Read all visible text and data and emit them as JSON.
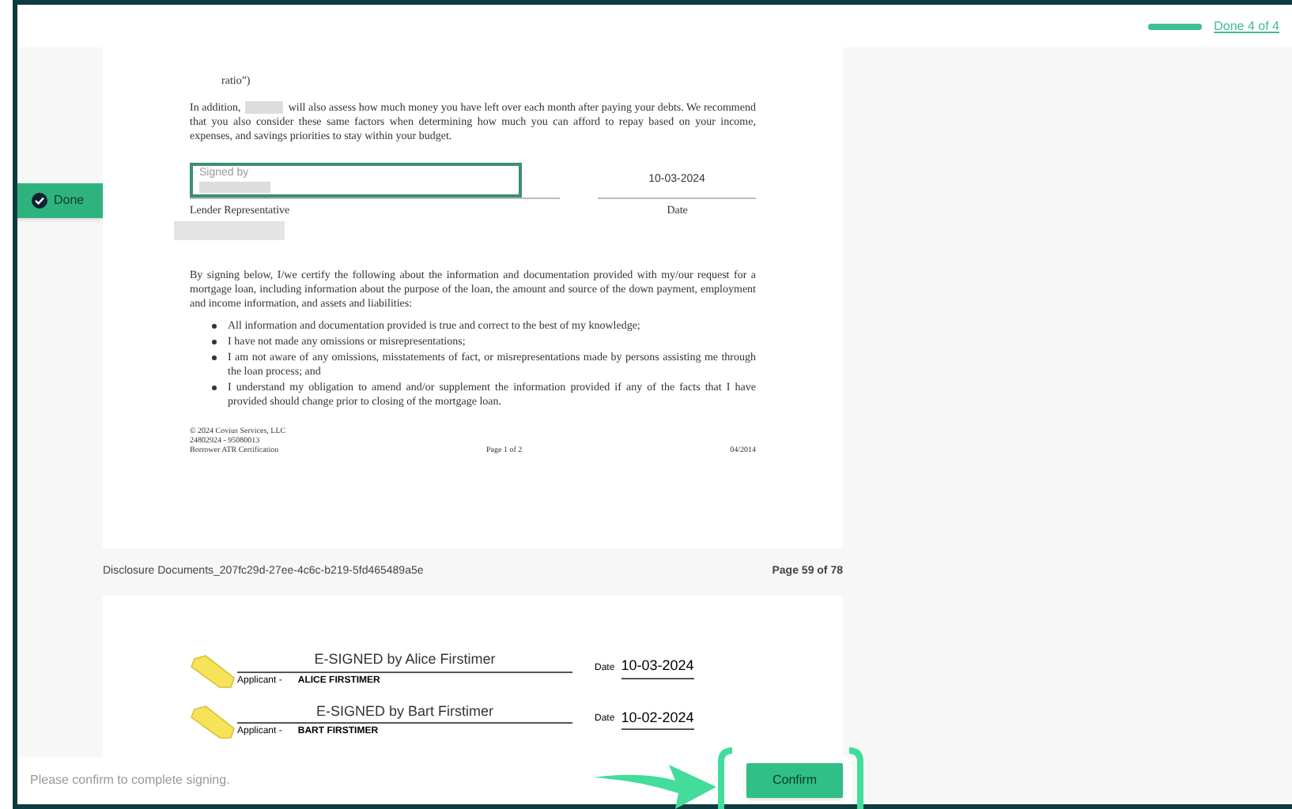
{
  "top_bar": {
    "progress": {
      "level": 1
    },
    "status_link": "Done 4 of 4"
  },
  "side_button": {
    "label": "Done"
  },
  "page_1": {
    "partial_line": "ratio”)",
    "paragraph": {
      "before": "In addition,",
      "after": "will also assess how much money you have left over each month after paying your debts. We recommend that you also consider these same factors when determining how much you can afford to repay based on your income, expenses, and savings priorities to stay within your budget."
    },
    "signature_field": {
      "label": "Signed by"
    },
    "signer_label": "Lender Representative",
    "date_value": "10-03-2024",
    "date_label": "Date",
    "certification": "By signing below, I/we certify the following about the information and documentation provided with my/our request for a mortgage loan, including information about the purpose of the loan, the amount and source of the down payment, employment and income information, and assets and liabilities:",
    "bullets": [
      "All information and documentation provided is true and correct to the best of my knowledge;",
      "I have not made any omissions or misrepresentations;",
      "I am not aware of any omissions, misstatements of fact, or misrepresentations made by persons assisting me through the loan process; and",
      "I understand my obligation to amend and/or supplement the information provided if any of the facts that I have provided should change prior to closing of the mortgage loan."
    ],
    "footer": {
      "copyright": "© 2024 Covius Services, LLC",
      "code": "24802924 - 95080013",
      "form": "Borrower ATR Certification",
      "page": "Page 1 of 2",
      "date": "04/2014"
    }
  },
  "document_caption": {
    "name": "Disclosure Documents_207fc29d-27ee-4c6c-b219-5fd465489a5e",
    "page": "Page 59 of 78"
  },
  "page_2": {
    "signatures": [
      {
        "signature": "E-SIGNED by Alice Firstimer",
        "role": "Applicant -",
        "name": "ALICE FIRSTIMER",
        "date_label": "Date",
        "date": "10-03-2024"
      },
      {
        "signature": "E-SIGNED by Bart Firstimer",
        "role": "Applicant -",
        "name": "BART FIRSTIMER",
        "date_label": "Date",
        "date": "10-02-2024"
      }
    ]
  },
  "footer": {
    "message": "Please confirm to complete signing.",
    "button": "Confirm"
  }
}
